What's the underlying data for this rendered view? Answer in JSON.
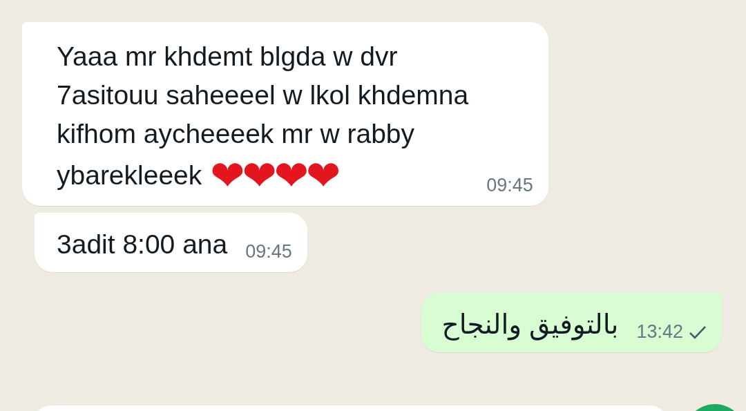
{
  "messages": [
    {
      "kind": "incoming",
      "lines": [
        "Yaaa mr khdemt blgda w dvr",
        "7asitouu saheeeel w lkol khdemna",
        "kifhom aycheeeek mr w rabby",
        "ybarekleeek"
      ],
      "emoji": "❤❤❤❤",
      "time": "09:45"
    },
    {
      "kind": "incoming",
      "lines": [
        "3adit 8:00 ana"
      ],
      "time": "09:45"
    },
    {
      "kind": "outgoing",
      "lines": [
        "بالتوفيق والنجاح"
      ],
      "time": "13:42",
      "delivered": true
    }
  ]
}
